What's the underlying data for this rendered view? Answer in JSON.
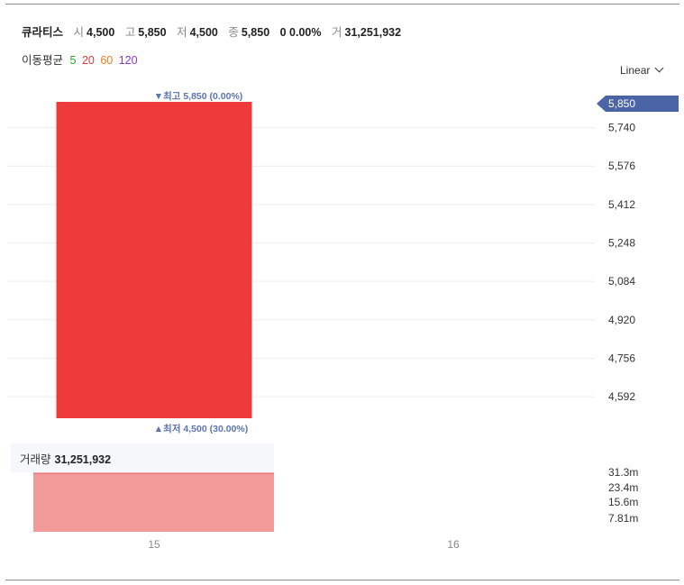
{
  "header": {
    "stock_name": "큐라티스",
    "open_label": "시",
    "open": "4,500",
    "high_label": "고",
    "high": "5,850",
    "low_label": "저",
    "low": "4,500",
    "close_label": "종",
    "close": "5,850",
    "change": "0 0.00%",
    "volume_label": "거",
    "volume": "31,251,932"
  },
  "moving_average": {
    "label": "이동평균",
    "periods": [
      {
        "text": "5",
        "color": "#2aa52a"
      },
      {
        "text": "20",
        "color": "#e03a3a"
      },
      {
        "text": "60",
        "color": "#ef7b1c"
      },
      {
        "text": "120",
        "color": "#8a35d6"
      }
    ]
  },
  "scale_selector": {
    "label": "Linear"
  },
  "volume_panel": {
    "label": "거래량",
    "value": "31,251,932"
  },
  "chart_data": {
    "type": "candlestick",
    "candles": [
      {
        "x": "15",
        "open": 4500,
        "high": 5850,
        "low": 4500,
        "close": 5850,
        "color": "#ee3a3a"
      }
    ],
    "x_ticks": [
      "15",
      "16"
    ],
    "y_ticks": [
      {
        "value": 5740,
        "label": "5,740"
      },
      {
        "value": 5576,
        "label": "5,576"
      },
      {
        "value": 5412,
        "label": "5,412"
      },
      {
        "value": 5248,
        "label": "5,248"
      },
      {
        "value": 5084,
        "label": "5,084"
      },
      {
        "value": 4920,
        "label": "4,920"
      },
      {
        "value": 4756,
        "label": "4,756"
      },
      {
        "value": 4592,
        "label": "4,592"
      }
    ],
    "ylim": [
      4500,
      5850
    ],
    "current_price": {
      "value": 5850,
      "label": "5,850",
      "color": "#4a64a6"
    },
    "high_annotation": {
      "value": 5850,
      "text": "▼최고 5,850 (0.00%)",
      "color": "#5b75b0"
    },
    "low_annotation": {
      "value": 4500,
      "text": "▲최저 4,500 (30.00%)",
      "color": "#5b75b0"
    },
    "volume": {
      "values": [
        31251932
      ],
      "color": "#f29a9a",
      "ylim": [
        0,
        31251932
      ],
      "ticks": [
        {
          "value": 31300000,
          "label": "31.3m"
        },
        {
          "value": 23400000,
          "label": "23.4m"
        },
        {
          "value": 15600000,
          "label": "15.6m"
        },
        {
          "value": 7810000,
          "label": "7.81m"
        }
      ]
    },
    "grid": true
  }
}
